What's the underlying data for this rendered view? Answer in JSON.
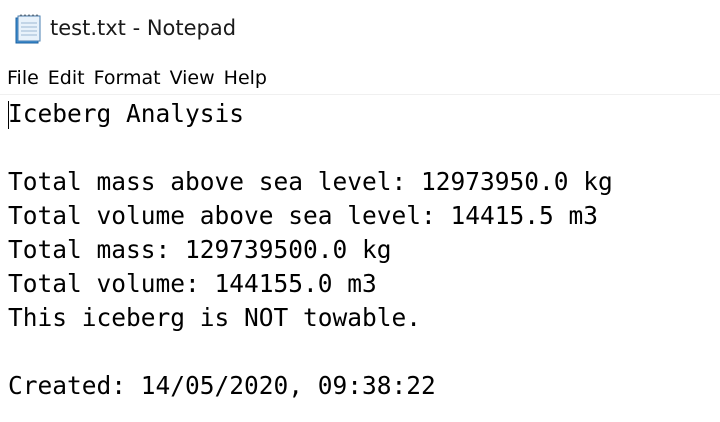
{
  "window": {
    "title": "test.txt - Notepad",
    "icon": "notepad-icon"
  },
  "menu": {
    "items": [
      {
        "label": "File"
      },
      {
        "label": "Edit"
      },
      {
        "label": "Format"
      },
      {
        "label": "View"
      },
      {
        "label": "Help"
      }
    ]
  },
  "document": {
    "lines": [
      "Iceberg Analysis",
      "",
      "Total mass above sea level: 12973950.0 kg",
      "Total volume above sea level: 14415.5 m3",
      "Total mass: 129739500.0 kg",
      "Total volume: 144155.0 m3",
      "This iceberg is NOT towable.",
      "",
      "Created: 14/05/2020, 09:38:22"
    ]
  }
}
